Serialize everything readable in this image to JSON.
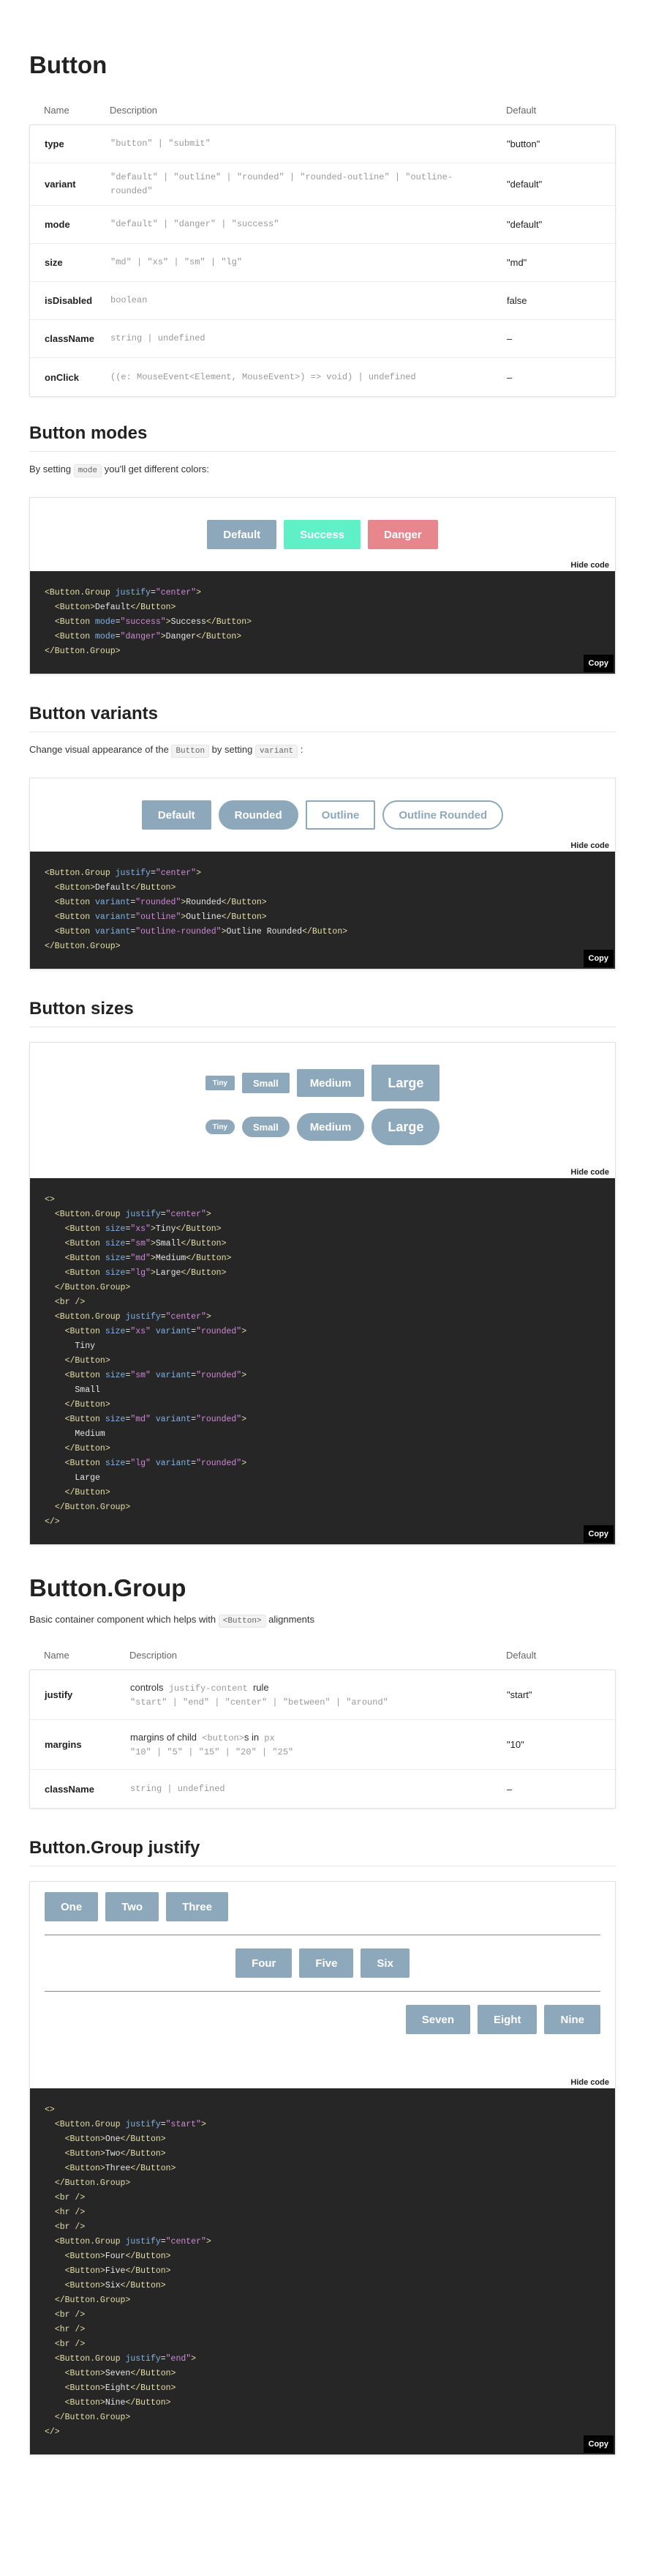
{
  "button_section": {
    "title": "Button",
    "headers": [
      "Name",
      "Description",
      "Default"
    ],
    "rows": [
      {
        "name": "type",
        "desc": "\"button\" | \"submit\"",
        "def": "\"button\""
      },
      {
        "name": "variant",
        "desc": "\"default\" | \"outline\" | \"rounded\" | \"rounded-outline\" | \"outline-rounded\"",
        "def": "\"default\""
      },
      {
        "name": "mode",
        "desc": "\"default\" | \"danger\" | \"success\"",
        "def": "\"default\""
      },
      {
        "name": "size",
        "desc": "\"md\" | \"xs\" | \"sm\" | \"lg\"",
        "def": "\"md\""
      },
      {
        "name": "isDisabled",
        "desc": "boolean",
        "def": "false"
      },
      {
        "name": "className",
        "desc": "string | undefined",
        "def": "–"
      },
      {
        "name": "onClick",
        "desc": "((e: MouseEvent<Element, MouseEvent>) => void) | undefined",
        "def": "–"
      }
    ]
  },
  "modes": {
    "title": "Button modes",
    "intro_a": "By setting",
    "intro_code": "mode",
    "intro_b": "you'll get different colors:",
    "buttons": [
      "Default",
      "Success",
      "Danger"
    ],
    "hide_code": "Hide code",
    "copy": "Copy"
  },
  "variants": {
    "title": "Button variants",
    "intro_a": "Change visual appearance of the",
    "intro_code1": "Button",
    "intro_b": "by setting",
    "intro_code2": "variant",
    "intro_c": ":",
    "buttons": [
      "Default",
      "Rounded",
      "Outline",
      "Outline Rounded"
    ],
    "hide_code": "Hide code",
    "copy": "Copy"
  },
  "sizes": {
    "title": "Button sizes",
    "buttons": [
      "Tiny",
      "Small",
      "Medium",
      "Large"
    ],
    "hide_code": "Hide code",
    "copy": "Copy"
  },
  "group": {
    "title": "Button.Group",
    "intro_a": "Basic container component which helps with",
    "intro_code": "<Button>",
    "intro_b": "alignments",
    "headers": [
      "Name",
      "Description",
      "Default"
    ],
    "rows": [
      {
        "name": "justify",
        "desc_a": "controls",
        "desc_code": "justify-content",
        "desc_b": "rule",
        "desc_values": "\"start\" | \"end\" | \"center\" | \"between\" | \"around\"",
        "def": "\"start\""
      },
      {
        "name": "margins",
        "desc_a": "margins of child",
        "desc_code": "<button>",
        "desc_b": "s in",
        "desc_code2": "px",
        "desc_values": "\"10\" | \"5\" | \"15\" | \"20\" | \"25\"",
        "def": "\"10\""
      },
      {
        "name": "className",
        "desc_values": "string | undefined",
        "def": "–"
      }
    ]
  },
  "justify": {
    "title": "Button.Group justify",
    "start_buttons": [
      "One",
      "Two",
      "Three"
    ],
    "center_buttons": [
      "Four",
      "Five",
      "Six"
    ],
    "end_buttons": [
      "Seven",
      "Eight",
      "Nine"
    ],
    "hide_code": "Hide code",
    "copy": "Copy"
  },
  "colors": {
    "primary": "#8ea8bb",
    "success": "#5ff0c7",
    "danger": "#e8868e",
    "code_bg": "#262626"
  }
}
